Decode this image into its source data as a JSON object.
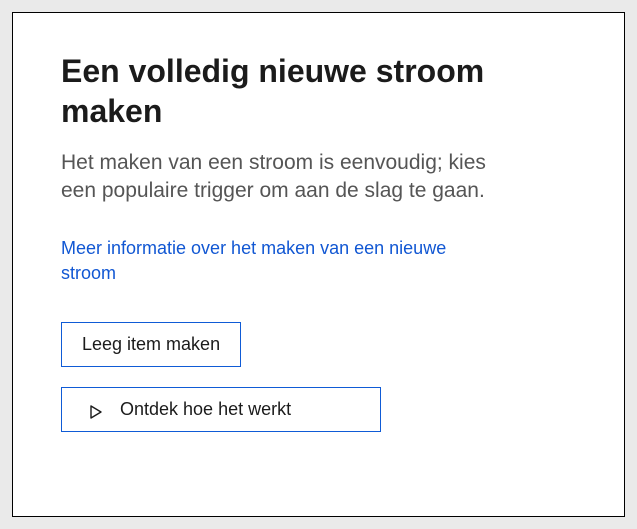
{
  "heading": "Een volledig nieuwe stroom maken",
  "description": "Het maken van een stroom is eenvoudig; kies een populaire trigger om aan de slag te gaan.",
  "learn_more_link": "Meer informatie over het maken van een nieuwe stroom",
  "actions": {
    "create_blank": "Leeg item maken",
    "discover": "Ontdek hoe het werkt"
  }
}
